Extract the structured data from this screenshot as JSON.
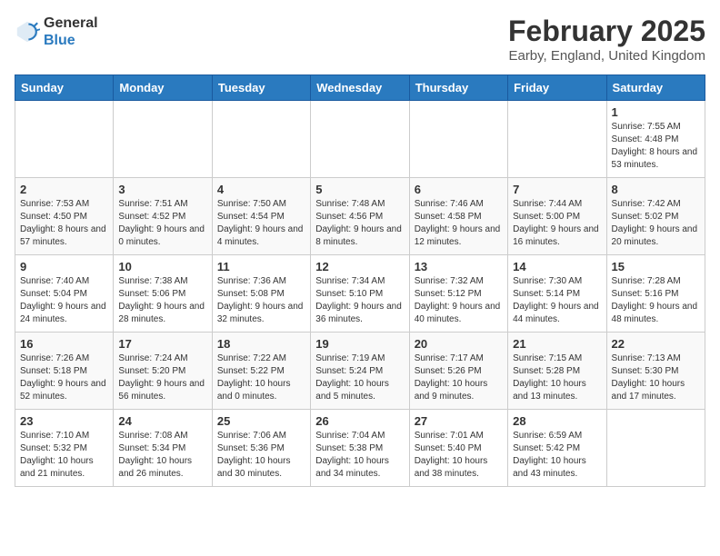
{
  "logo": {
    "general": "General",
    "blue": "Blue"
  },
  "title": "February 2025",
  "subtitle": "Earby, England, United Kingdom",
  "headers": [
    "Sunday",
    "Monday",
    "Tuesday",
    "Wednesday",
    "Thursday",
    "Friday",
    "Saturday"
  ],
  "weeks": [
    [
      {
        "day": "",
        "info": ""
      },
      {
        "day": "",
        "info": ""
      },
      {
        "day": "",
        "info": ""
      },
      {
        "day": "",
        "info": ""
      },
      {
        "day": "",
        "info": ""
      },
      {
        "day": "",
        "info": ""
      },
      {
        "day": "1",
        "info": "Sunrise: 7:55 AM\nSunset: 4:48 PM\nDaylight: 8 hours and 53 minutes."
      }
    ],
    [
      {
        "day": "2",
        "info": "Sunrise: 7:53 AM\nSunset: 4:50 PM\nDaylight: 8 hours and 57 minutes."
      },
      {
        "day": "3",
        "info": "Sunrise: 7:51 AM\nSunset: 4:52 PM\nDaylight: 9 hours and 0 minutes."
      },
      {
        "day": "4",
        "info": "Sunrise: 7:50 AM\nSunset: 4:54 PM\nDaylight: 9 hours and 4 minutes."
      },
      {
        "day": "5",
        "info": "Sunrise: 7:48 AM\nSunset: 4:56 PM\nDaylight: 9 hours and 8 minutes."
      },
      {
        "day": "6",
        "info": "Sunrise: 7:46 AM\nSunset: 4:58 PM\nDaylight: 9 hours and 12 minutes."
      },
      {
        "day": "7",
        "info": "Sunrise: 7:44 AM\nSunset: 5:00 PM\nDaylight: 9 hours and 16 minutes."
      },
      {
        "day": "8",
        "info": "Sunrise: 7:42 AM\nSunset: 5:02 PM\nDaylight: 9 hours and 20 minutes."
      }
    ],
    [
      {
        "day": "9",
        "info": "Sunrise: 7:40 AM\nSunset: 5:04 PM\nDaylight: 9 hours and 24 minutes."
      },
      {
        "day": "10",
        "info": "Sunrise: 7:38 AM\nSunset: 5:06 PM\nDaylight: 9 hours and 28 minutes."
      },
      {
        "day": "11",
        "info": "Sunrise: 7:36 AM\nSunset: 5:08 PM\nDaylight: 9 hours and 32 minutes."
      },
      {
        "day": "12",
        "info": "Sunrise: 7:34 AM\nSunset: 5:10 PM\nDaylight: 9 hours and 36 minutes."
      },
      {
        "day": "13",
        "info": "Sunrise: 7:32 AM\nSunset: 5:12 PM\nDaylight: 9 hours and 40 minutes."
      },
      {
        "day": "14",
        "info": "Sunrise: 7:30 AM\nSunset: 5:14 PM\nDaylight: 9 hours and 44 minutes."
      },
      {
        "day": "15",
        "info": "Sunrise: 7:28 AM\nSunset: 5:16 PM\nDaylight: 9 hours and 48 minutes."
      }
    ],
    [
      {
        "day": "16",
        "info": "Sunrise: 7:26 AM\nSunset: 5:18 PM\nDaylight: 9 hours and 52 minutes."
      },
      {
        "day": "17",
        "info": "Sunrise: 7:24 AM\nSunset: 5:20 PM\nDaylight: 9 hours and 56 minutes."
      },
      {
        "day": "18",
        "info": "Sunrise: 7:22 AM\nSunset: 5:22 PM\nDaylight: 10 hours and 0 minutes."
      },
      {
        "day": "19",
        "info": "Sunrise: 7:19 AM\nSunset: 5:24 PM\nDaylight: 10 hours and 5 minutes."
      },
      {
        "day": "20",
        "info": "Sunrise: 7:17 AM\nSunset: 5:26 PM\nDaylight: 10 hours and 9 minutes."
      },
      {
        "day": "21",
        "info": "Sunrise: 7:15 AM\nSunset: 5:28 PM\nDaylight: 10 hours and 13 minutes."
      },
      {
        "day": "22",
        "info": "Sunrise: 7:13 AM\nSunset: 5:30 PM\nDaylight: 10 hours and 17 minutes."
      }
    ],
    [
      {
        "day": "23",
        "info": "Sunrise: 7:10 AM\nSunset: 5:32 PM\nDaylight: 10 hours and 21 minutes."
      },
      {
        "day": "24",
        "info": "Sunrise: 7:08 AM\nSunset: 5:34 PM\nDaylight: 10 hours and 26 minutes."
      },
      {
        "day": "25",
        "info": "Sunrise: 7:06 AM\nSunset: 5:36 PM\nDaylight: 10 hours and 30 minutes."
      },
      {
        "day": "26",
        "info": "Sunrise: 7:04 AM\nSunset: 5:38 PM\nDaylight: 10 hours and 34 minutes."
      },
      {
        "day": "27",
        "info": "Sunrise: 7:01 AM\nSunset: 5:40 PM\nDaylight: 10 hours and 38 minutes."
      },
      {
        "day": "28",
        "info": "Sunrise: 6:59 AM\nSunset: 5:42 PM\nDaylight: 10 hours and 43 minutes."
      },
      {
        "day": "",
        "info": ""
      }
    ]
  ]
}
